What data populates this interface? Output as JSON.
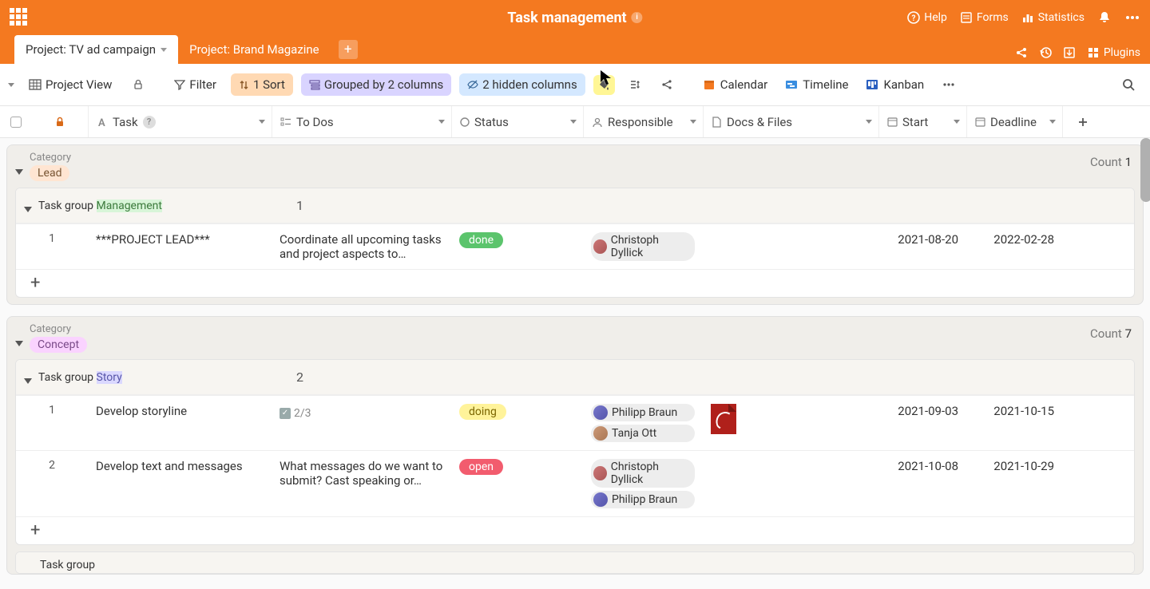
{
  "header": {
    "title": "Task management",
    "nav": {
      "help": "Help",
      "forms": "Forms",
      "statistics": "Statistics"
    }
  },
  "tabs": {
    "active": "Project: TV ad campaign",
    "inactive": "Project: Brand Magazine",
    "plugins": "Plugins"
  },
  "toolbar": {
    "view": "Project View",
    "filter": "Filter",
    "sort": "1 Sort",
    "grouped": "Grouped by 2 columns",
    "hidden": "2 hidden columns",
    "links": {
      "calendar": "Calendar",
      "timeline": "Timeline",
      "kanban": "Kanban"
    }
  },
  "columns": {
    "task": "Task",
    "todo": "To Dos",
    "status": "Status",
    "responsible": "Responsible",
    "docs": "Docs & Files",
    "start": "Start",
    "deadline": "Deadline"
  },
  "labels": {
    "category": "Category",
    "taskgroup": "Task group",
    "count": "Count"
  },
  "groups": [
    {
      "category_label": "Lead",
      "chip_class": "chip-lead",
      "count": "1",
      "subgroups": [
        {
          "name": "Management",
          "chip_class": "chip-mgmt",
          "count": "1",
          "rows": [
            {
              "num": "1",
              "task": "***PROJECT LEAD***",
              "todo": "Coordinate all upcoming tasks and project aspects to…",
              "status": "done",
              "status_class": "status-done",
              "responsible": [
                {
                  "name": "Christoph Dyllick",
                  "avatar": "a1"
                }
              ],
              "docs": "",
              "start": "2021-08-20",
              "deadline": "2022-02-28"
            }
          ]
        }
      ]
    },
    {
      "category_label": "Concept",
      "chip_class": "chip-concept",
      "count": "7",
      "subgroups": [
        {
          "name": "Story",
          "chip_class": "chip-story",
          "count": "2",
          "rows": [
            {
              "num": "1",
              "task": "Develop storyline",
              "todo_checklist": "2/3",
              "status": "doing",
              "status_class": "status-doing",
              "responsible": [
                {
                  "name": "Philipp Braun",
                  "avatar": "a2"
                },
                {
                  "name": "Tanja Ott",
                  "avatar": "a3"
                }
              ],
              "docs": "pdf",
              "start": "2021-09-03",
              "deadline": "2021-10-15"
            },
            {
              "num": "2",
              "task": "Develop text and messages",
              "todo": "What messages do we want to submit? Cast speaking or…",
              "status": "open",
              "status_class": "status-open",
              "responsible": [
                {
                  "name": "Christoph Dyllick",
                  "avatar": "a1"
                },
                {
                  "name": "Philipp Braun",
                  "avatar": "a2"
                }
              ],
              "docs": "",
              "start": "2021-10-08",
              "deadline": "2021-10-29"
            }
          ]
        }
      ],
      "partial_subgroup": true
    }
  ]
}
